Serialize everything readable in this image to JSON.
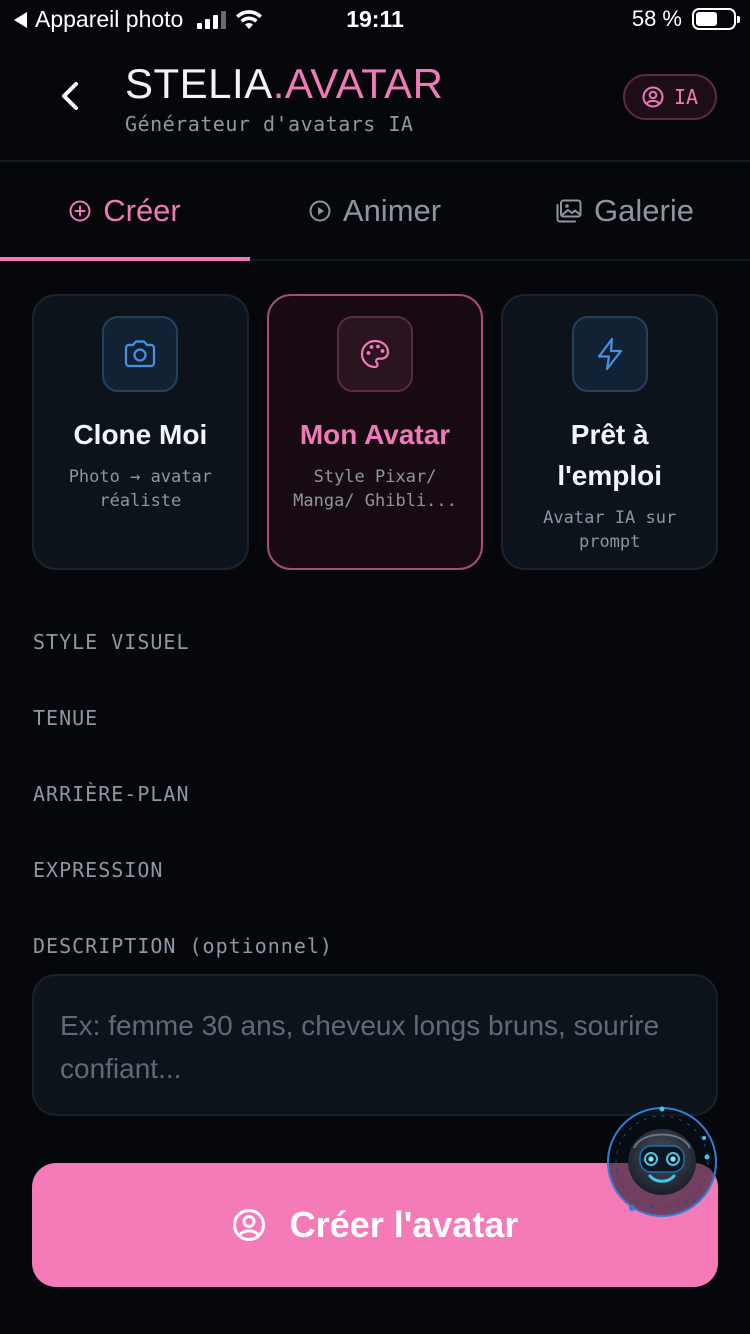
{
  "status_bar": {
    "back_app": "Appareil photo",
    "time": "19:11",
    "battery": "58 %",
    "battery_level": 0.58
  },
  "header": {
    "brand_main": "STELIA",
    "brand_accent": ".AVATAR",
    "subtitle": "Générateur d'avatars IA",
    "badge": "IA"
  },
  "tabs": [
    {
      "label": "Créer",
      "icon": "plus-circle-icon",
      "active": true
    },
    {
      "label": "Animer",
      "icon": "play-circle-icon",
      "active": false
    },
    {
      "label": "Galerie",
      "icon": "image-gallery-icon",
      "active": false
    }
  ],
  "modes": [
    {
      "title": "Clone Moi",
      "desc": "Photo → avatar réaliste",
      "icon": "camera-icon",
      "selected": false
    },
    {
      "title": "Mon Avatar",
      "desc": "Style Pixar/ Manga/ Ghibli...",
      "icon": "palette-icon",
      "selected": true
    },
    {
      "title": "Prêt à l'emploi",
      "desc": "Avatar IA sur prompt",
      "icon": "lightning-icon",
      "selected": false
    }
  ],
  "sections": {
    "style": "STYLE VISUEL",
    "outfit": "TENUE",
    "background": "ARRIÈRE-PLAN",
    "expression": "EXPRESSION",
    "description": "DESCRIPTION (optionnel)"
  },
  "description_input": {
    "value": "",
    "placeholder": "Ex: femme 30 ans, cheveux longs bruns, sourire confiant..."
  },
  "create_button": {
    "label": "Créer l'avatar"
  },
  "colors": {
    "accent": "#f07ab7",
    "button": "#f47ab8",
    "background": "#05070b",
    "card": "#0d131b",
    "blue_icon": "#4a90e2"
  }
}
